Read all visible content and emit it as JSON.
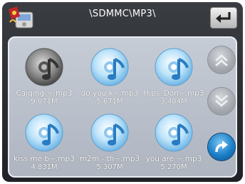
{
  "header": {
    "path": "\\SDMMC\\MP3\\",
    "app_icon": "music-device-icon",
    "back_icon": "return-arrow-icon"
  },
  "files": [
    {
      "name": "Caiqing-~.mp3",
      "size": "9.071M",
      "icon": "music-disc-dark-icon"
    },
    {
      "name": "do you k~.mp3",
      "size": "5.671M",
      "icon": "music-disc-icon"
    },
    {
      "name": "Hips_Don~.mp3",
      "size": "3.484M",
      "icon": "music-disc-icon"
    },
    {
      "name": "kiss me b~.mp3",
      "size": "4.831M",
      "icon": "music-disc-icon"
    },
    {
      "name": "m2m - th~.mp3",
      "size": "5.307M",
      "icon": "music-disc-icon"
    },
    {
      "name": "you are ~.mp3",
      "size": "5.270M",
      "icon": "music-disc-icon"
    }
  ],
  "controls": {
    "page_up_icon": "double-chevron-up-icon",
    "page_down_icon": "double-chevron-down-icon",
    "enter_icon": "curved-arrow-icon"
  }
}
